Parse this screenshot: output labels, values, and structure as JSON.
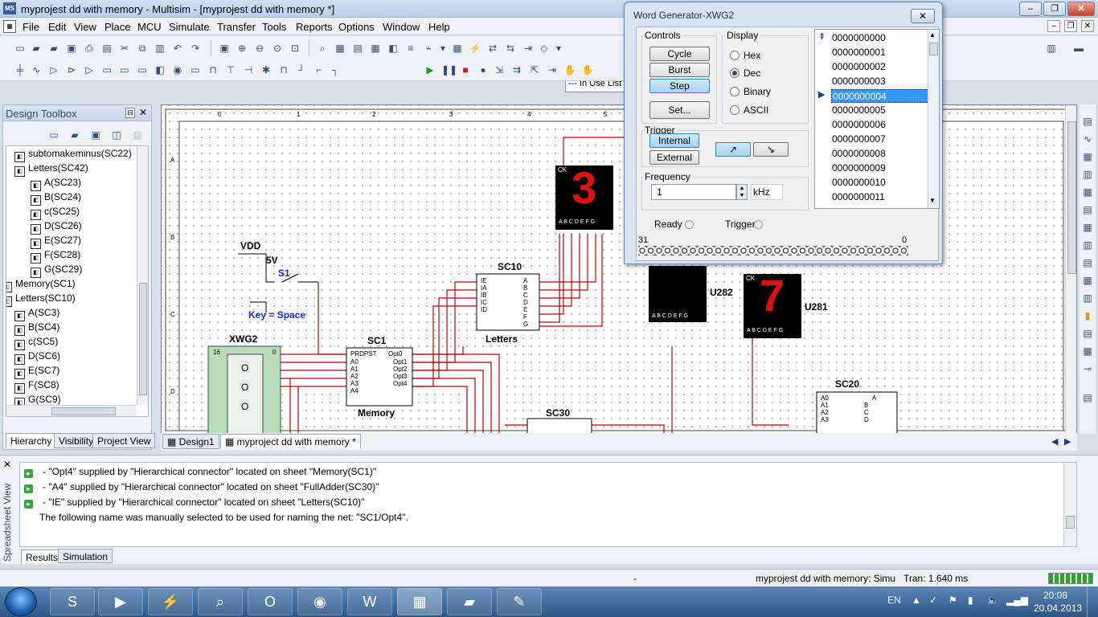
{
  "window": {
    "title": "myprojest dd with memory - Multisim - [myprojest dd with memory *]",
    "app_icon_text": "MS"
  },
  "menu": [
    "File",
    "Edit",
    "View",
    "Place",
    "MCU",
    "Simulate",
    "Transfer",
    "Tools",
    "Reports",
    "Options",
    "Window",
    "Help"
  ],
  "toolbar": {
    "in_use_list": "--- In Use List ---"
  },
  "toolbox": {
    "title": "Design Toolbox",
    "tree": [
      {
        "label": "subtomakeminus(SC22)",
        "indent": 1
      },
      {
        "label": "Letters(SC42)",
        "indent": 1
      },
      {
        "label": "A(SC23)",
        "indent": 2
      },
      {
        "label": "B(SC24)",
        "indent": 2
      },
      {
        "label": "c(SC25)",
        "indent": 2
      },
      {
        "label": "D(SC26)",
        "indent": 2
      },
      {
        "label": "E(SC27)",
        "indent": 2
      },
      {
        "label": "F(SC28)",
        "indent": 2
      },
      {
        "label": "G(SC29)",
        "indent": 2
      },
      {
        "label": "Memory(SC1)",
        "indent": 0
      },
      {
        "label": "Letters(SC10)",
        "indent": 0
      },
      {
        "label": "A(SC3)",
        "indent": 1
      },
      {
        "label": "B(SC4)",
        "indent": 1
      },
      {
        "label": "c(SC5)",
        "indent": 1
      },
      {
        "label": "D(SC6)",
        "indent": 1
      },
      {
        "label": "E(SC7)",
        "indent": 1
      },
      {
        "label": "F(SC8)",
        "indent": 1
      },
      {
        "label": "G(SC9)",
        "indent": 1
      }
    ],
    "tabs": [
      "Hierarchy",
      "Visibility",
      "Project View"
    ]
  },
  "schematic": {
    "ruler_top": [
      "0",
      "1",
      "2",
      "3",
      "4",
      "5"
    ],
    "ruler_left": [
      "A",
      "B",
      "C",
      "D"
    ],
    "vdd": "VDD",
    "voltage": "5V",
    "switch": "S1",
    "key_label": "Key = Space",
    "xwg": "XWG2",
    "xwg_pins_left": "16",
    "xwg_pins_right": "0",
    "sc1": "SC1",
    "sc1_caption": "Memory",
    "sc1_pins_left": [
      "PRDPST",
      "A0",
      "A1",
      "A2",
      "A3",
      "A4"
    ],
    "sc1_pins_right": [
      "Opt0",
      "Opt1",
      "Opt2",
      "Opt3",
      "Opt4"
    ],
    "sc10": "SC10",
    "sc10_caption": "Letters",
    "sc10_pins_left": [
      "IE",
      "IA",
      "IB",
      "IC",
      "ID"
    ],
    "sc10_pins_right": [
      "A",
      "B",
      "C",
      "D",
      "E",
      "F",
      "G"
    ],
    "sc30": "SC30",
    "sc20": "SC20",
    "sc20_pins_left": [
      "A0",
      "A1",
      "A2",
      "A3"
    ],
    "sc20_pins_right": [
      "A",
      "B",
      "C",
      "D"
    ],
    "u282": "U282",
    "u281": "U281",
    "seg_pins": "A B C D E F G",
    "ck": "CK",
    "display1_digit": "3",
    "display3_digit": "7"
  },
  "sheet_tabs": [
    "Design1",
    "myproject dd with memory *"
  ],
  "messages": [
    {
      "icon": "check",
      "text": "- \"Opt4\" supplied by \"Hierarchical connector\" located on sheet \"Memory(SC1)\""
    },
    {
      "icon": "check",
      "text": "- \"A4\" supplied by \"Hierarchical connector\" located on sheet \"FullAdder(SC30)\""
    },
    {
      "icon": "check",
      "text": "- \"IE\" supplied by \"Hierarchical connector\" located on sheet \"Letters(SC10)\""
    },
    {
      "icon": "none",
      "text": "The following name was manually selected to be used for naming the net: \"SC1/Opt4\"."
    }
  ],
  "spreadsheet": {
    "side_label": "Spreadsheet View",
    "tabs": [
      "Results",
      "Simulation"
    ]
  },
  "status": {
    "dash": "-",
    "sim": "myprojest dd with memory: Simu",
    "tran": "Tran: 1.640 ms"
  },
  "taskbar": {
    "lang": "EN",
    "time": "20:08",
    "date": "20.04.2013"
  },
  "wordgen": {
    "title": "Word Generator-XWG2",
    "controls_label": "Controls",
    "buttons": [
      "Cycle",
      "Burst",
      "Step",
      "Set..."
    ],
    "display_label": "Display",
    "display_options": [
      "Hex",
      "Dec",
      "Binary",
      "ASCII"
    ],
    "display_selected": "Dec",
    "trigger_label": "Trigger",
    "trigger_buttons": [
      "Internal",
      "External"
    ],
    "frequency_label": "Frequency",
    "frequency_value": "1",
    "frequency_unit": "kHz",
    "ready_label": "Ready",
    "trigger_status_label": "Trigger",
    "bit_high": "31",
    "bit_low": "0",
    "words": [
      "0000000000",
      "0000000001",
      "0000000002",
      "0000000003",
      "0000000004",
      "0000000005",
      "0000000006",
      "0000000007",
      "0000000008",
      "0000000009",
      "0000000010",
      "0000000011"
    ],
    "selected_index": 4
  }
}
